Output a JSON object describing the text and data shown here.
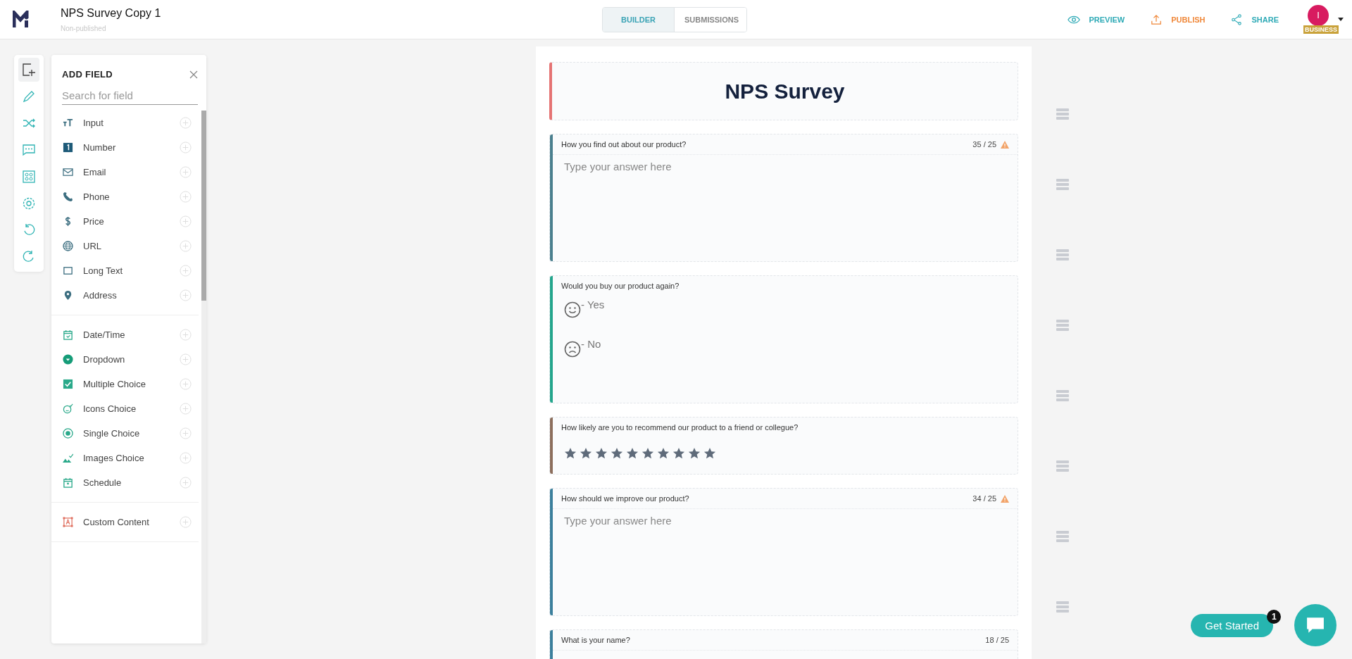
{
  "header": {
    "title": "NPS Survey Copy 1",
    "status": "Non-published",
    "tabs": [
      {
        "label": "BUILDER",
        "selected": true
      },
      {
        "label": "SUBMISSIONS",
        "selected": false
      }
    ],
    "actions": [
      {
        "label": "PREVIEW",
        "color": "#2eaab6"
      },
      {
        "label": "PUBLISH",
        "color": "#f0883a"
      },
      {
        "label": "SHARE",
        "color": "#2eaab6"
      }
    ],
    "avatar": {
      "initial": "I",
      "badge": "BUSINESS"
    }
  },
  "toolbar": {
    "tools": [
      {
        "selected": true
      },
      {
        "selected": false
      },
      {
        "selected": false
      },
      {
        "selected": false
      },
      {
        "selected": false
      },
      {
        "selected": false
      },
      {
        "selected": false
      },
      {
        "selected": false
      }
    ]
  },
  "add_field": {
    "title": "ADD FIELD",
    "search": {
      "placeholder": "Search for field"
    },
    "groups": [
      {
        "items": [
          "Input",
          "Number",
          "Email",
          "Phone",
          "Price",
          "URL",
          "Long Text",
          "Address"
        ]
      },
      {
        "items": [
          "Date/Time",
          "Dropdown",
          "Multiple Choice",
          "Icons Choice",
          "Single Choice",
          "Images Choice",
          "Schedule"
        ]
      },
      {
        "items": [
          "Custom Content"
        ]
      }
    ]
  },
  "form": {
    "title": "NPS Survey",
    "questions": [
      {
        "kind": "text",
        "label": "How you find out about our product?",
        "counter": "35 / 25",
        "over_limit": true,
        "placeholder": "Type your answer here",
        "color": "#4a7f8e"
      },
      {
        "kind": "emoji",
        "label": "Would you buy our product again?",
        "options": [
          {
            "kind": "happy",
            "label": "- Yes"
          },
          {
            "kind": "sad",
            "label": "- No"
          }
        ],
        "color": "#23a58c"
      },
      {
        "kind": "rating",
        "label": "How likely are you to recommend our product to a friend or collegue?",
        "color": "#8c6e5c"
      },
      {
        "kind": "text",
        "label": "How should we improve our product?",
        "counter": "34 / 25",
        "over_limit": true,
        "placeholder": "Type your answer here",
        "color": "#3b7f9c"
      },
      {
        "kind": "text",
        "label": "What is your name?",
        "counter": "18 / 25",
        "over_limit": false,
        "color": "#3b7f9c"
      }
    ]
  },
  "chat": {
    "button": "Get Started",
    "badge": "1"
  }
}
